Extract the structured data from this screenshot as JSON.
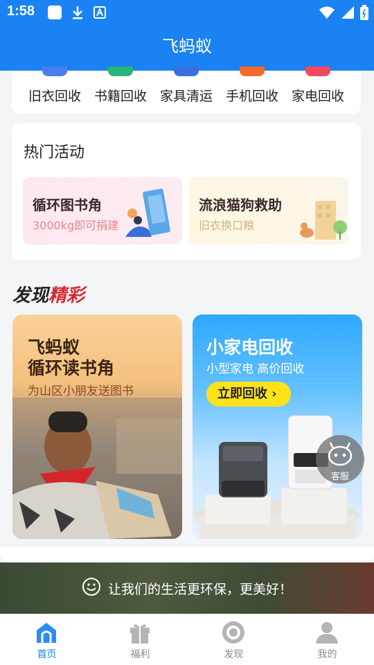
{
  "status_bar": {
    "time": "1:58"
  },
  "header": {
    "title": "飞蚂蚁"
  },
  "categories": [
    {
      "label": "旧衣回收",
      "color": "#4a7df0"
    },
    {
      "label": "书籍回收",
      "color": "#28b57a"
    },
    {
      "label": "家具清运",
      "color": "#3b6fe0"
    },
    {
      "label": "手机回收",
      "color": "#f56a2a"
    },
    {
      "label": "家电回收",
      "color": "#f24a5a"
    }
  ],
  "hot": {
    "title": "热门活动",
    "activities": [
      {
        "title": "循环图书角",
        "subtitle": "3000kg即可捐建"
      },
      {
        "title": "流浪猫狗救助",
        "subtitle": "旧衣换口粮"
      }
    ]
  },
  "discover": {
    "title_part1": "发现",
    "title_part2": "精彩",
    "banners": [
      {
        "line1": "飞蚂蚁",
        "line2": "循环读书角",
        "subtitle": "为山区小朋友送图书"
      },
      {
        "title": "小家电回收",
        "subtitle": "小型家电 高价回收",
        "button": "立即回收 ›"
      }
    ]
  },
  "service": {
    "label": "客服"
  },
  "slogan": {
    "text": "让我们的生活更环保，更美好！"
  },
  "tabbar": {
    "items": [
      {
        "label": "首页",
        "active": true
      },
      {
        "label": "福利"
      },
      {
        "label": "发现"
      },
      {
        "label": "我的"
      }
    ]
  },
  "colors": {
    "primary": "#1a82f3",
    "accent_red": "#d9272f",
    "button_yellow": "#ffe21a"
  }
}
